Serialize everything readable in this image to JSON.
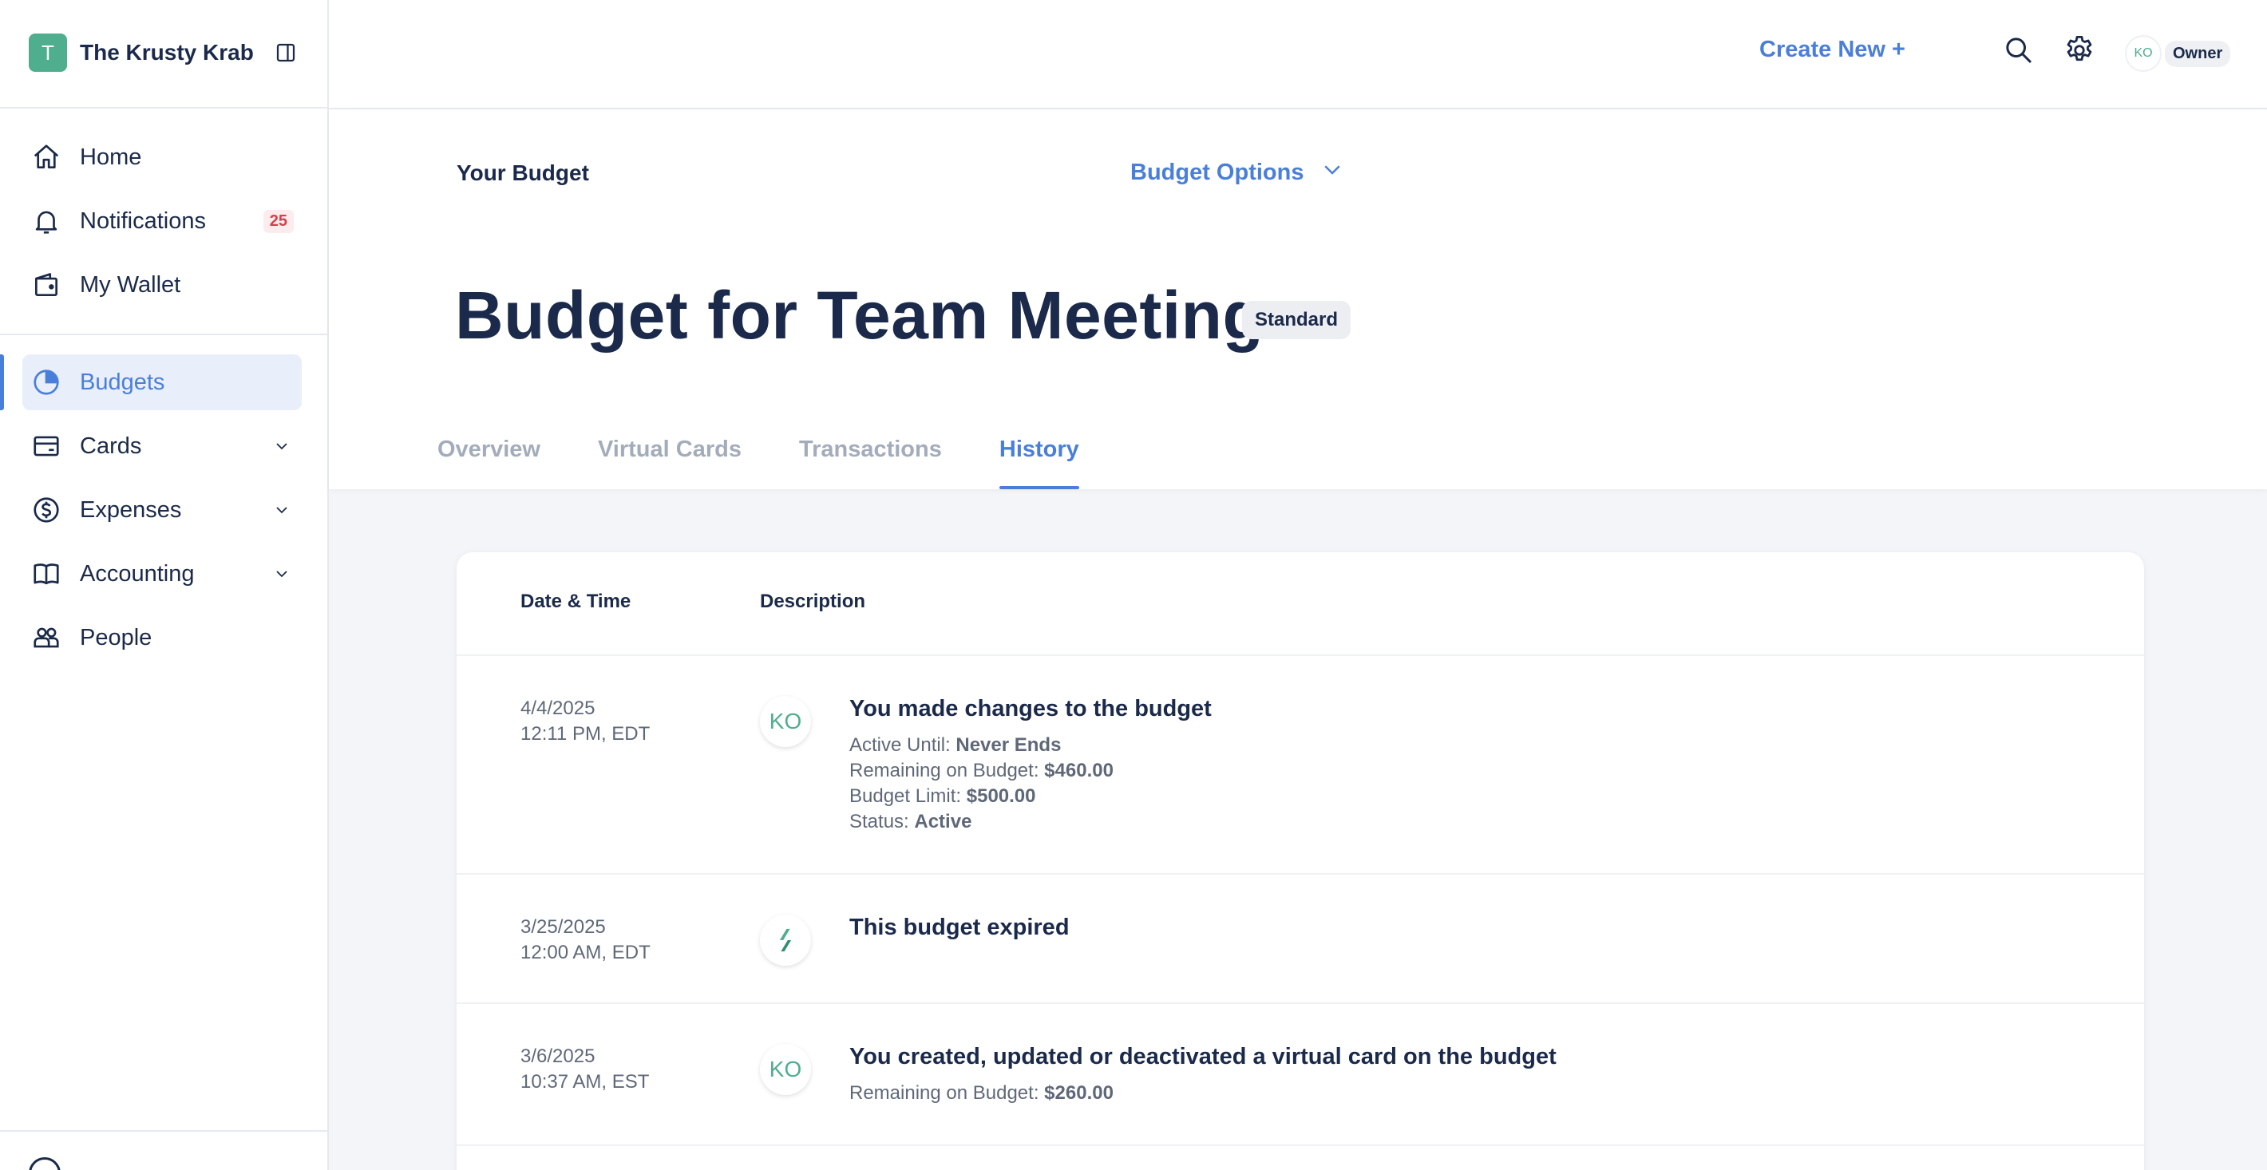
{
  "org": {
    "logo_letter": "T",
    "name": "The Krusty Krab"
  },
  "sidebar": {
    "items": [
      {
        "label": "Home",
        "icon": "home-icon"
      },
      {
        "label": "Notifications",
        "icon": "bell-icon",
        "count": "25"
      },
      {
        "label": "My Wallet",
        "icon": "wallet-icon"
      },
      {
        "label": "Budgets",
        "icon": "pie-chart-icon",
        "active": true
      },
      {
        "label": "Cards",
        "icon": "card-icon",
        "expandable": true
      },
      {
        "label": "Expenses",
        "icon": "dollar-circle-icon",
        "expandable": true
      },
      {
        "label": "Accounting",
        "icon": "book-icon",
        "expandable": true
      },
      {
        "label": "People",
        "icon": "people-icon"
      }
    ]
  },
  "topbar": {
    "create_new": "Create New +",
    "user_initials": "KO",
    "user_role": "Owner"
  },
  "header": {
    "section": "Your Budget",
    "options": "Budget Options",
    "title": "Budget for Team Meeting",
    "type_badge": "Standard",
    "tabs": [
      {
        "label": "Overview"
      },
      {
        "label": "Virtual Cards"
      },
      {
        "label": "Transactions"
      },
      {
        "label": "History",
        "active": true
      }
    ]
  },
  "history": {
    "columns": {
      "date": "Date & Time",
      "description": "Description"
    },
    "rows": [
      {
        "date": "4/4/2025",
        "time": "12:11 PM, EDT",
        "actor": "KO",
        "title": "You made changes to the budget",
        "details": [
          {
            "label": "Active Until: ",
            "value": "Never Ends"
          },
          {
            "label": "Remaining on Budget: ",
            "value": "$460.00"
          },
          {
            "label": "Budget Limit: ",
            "value": "$500.00"
          },
          {
            "label": "Status: ",
            "value": "Active"
          }
        ]
      },
      {
        "date": "3/25/2025",
        "time": "12:00 AM, EDT",
        "actor": "",
        "title": "This budget expired",
        "details": []
      },
      {
        "date": "3/6/2025",
        "time": "10:37 AM, EST",
        "actor": "KO",
        "title": "You created, updated or deactivated a virtual card on the budget",
        "details": [
          {
            "label": "Remaining on Budget: ",
            "value": "$260.00"
          }
        ]
      }
    ]
  },
  "colors": {
    "accent": "#4a7fd9",
    "brand_green": "#4eae8e",
    "text": "#1b2a4a",
    "badge_red": "#d2414d"
  }
}
